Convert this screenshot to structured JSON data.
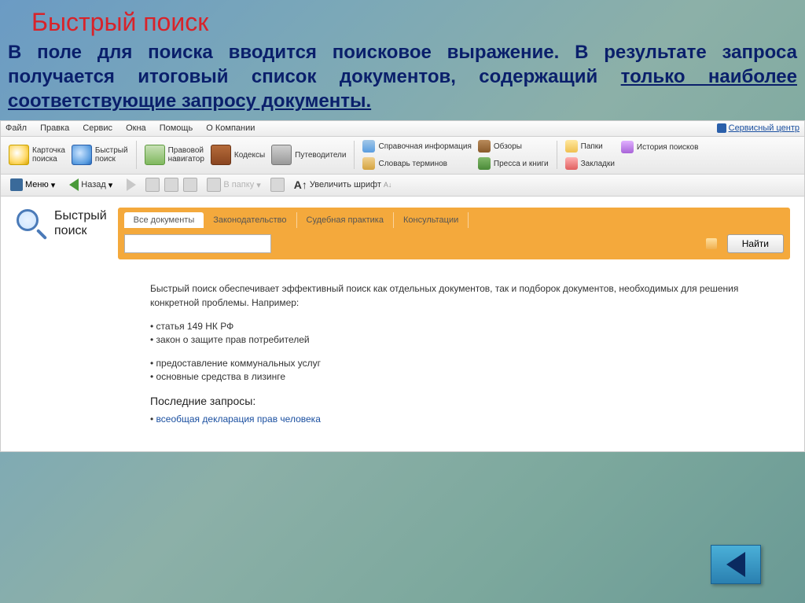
{
  "slide": {
    "title": "Быстрый поиск",
    "desc_plain": "В поле для поиска вводится поисковое выражение. В результате запроса получается итоговый список документов, содержащий ",
    "desc_underlined": "только наиболее соответствующие запросу документы."
  },
  "menubar": {
    "items": [
      "Файл",
      "Правка",
      "Сервис",
      "Окна",
      "Помощь",
      "О Компании"
    ],
    "service_center": "Сервисный центр"
  },
  "toolbar1": {
    "search_card": "Карточка\nпоиска",
    "quick_search": "Быстрый\nпоиск",
    "legal_nav": "Правовой\nнавигатор",
    "codex": "Кодексы",
    "guides": "Путеводители",
    "ref_info": "Справочная информация",
    "dict": "Словарь терминов",
    "reviews": "Обзоры",
    "press": "Пресса и книги",
    "folders": "Папки",
    "history": "История поисков",
    "bookmarks": "Закладки"
  },
  "toolbar2": {
    "menu": "Меню",
    "back": "Назад",
    "to_folder": "В папку",
    "zoom": "Увеличить шрифт"
  },
  "search": {
    "label_line1": "Быстрый",
    "label_line2": "поиск",
    "tabs": [
      "Все документы",
      "Законодательство",
      "Судебная практика",
      "Консультации"
    ],
    "active_tab": 0,
    "input_value": "",
    "find_btn": "Найти"
  },
  "content": {
    "desc": "Быстрый поиск обеспечивает эффективный поиск как отдельных документов, так и подборок документов, необходимых для решения конкретной проблемы. Например:",
    "examples1": [
      "статья 149 НК РФ",
      "закон о защите прав потребителей"
    ],
    "examples2": [
      "предоставление коммунальных услуг",
      "основные средства в лизинге"
    ],
    "recent_title": "Последние запросы:",
    "recent_items": [
      "всеобщая декларация прав человека"
    ]
  }
}
